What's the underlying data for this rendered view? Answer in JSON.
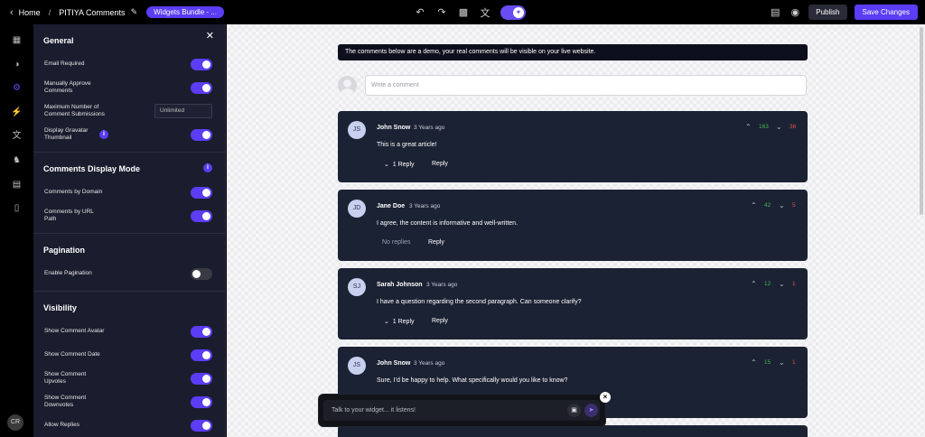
{
  "topbar": {
    "back_label": "Home",
    "separator": "/",
    "widget_name": "PITIYA Comments",
    "bundle_label": "Widgets Bundle - ...",
    "publish_label": "Publish",
    "save_label": "Save Changes",
    "icons": [
      "undo-icon",
      "redo-icon",
      "paint-icon",
      "translate-icon",
      "ai-assistant-icon",
      "database-icon",
      "eye-icon"
    ]
  },
  "rail": {
    "items": [
      "dashboard-icon",
      "palette-icon",
      "gear-icon",
      "plug-icon",
      "translate-icon",
      "bell-icon",
      "layout-icon",
      "analytics-icon"
    ],
    "active": "gear-icon",
    "avatar_initials": "CR"
  },
  "panel": {
    "general": {
      "title": "General",
      "email_required": "Email Required",
      "manually_approve": "Manually Approve Comments",
      "max_submissions": "Maximum Number of Comment Submissions",
      "max_submissions_value": "Unlimited",
      "display_gravatar": "Display Gravatar Thumbnail"
    },
    "display_mode": {
      "title": "Comments Display Mode",
      "by_domain": "Comments by Domain",
      "by_url": "Comments by URL Path"
    },
    "pagination": {
      "title": "Pagination",
      "enable": "Enable Pagination"
    },
    "visibility": {
      "title": "Visibility",
      "avatar": "Show Comment Avatar",
      "date": "Show Comment Date",
      "upvotes": "Show Comment Upvotes",
      "downvotes": "Show Comment Downvotes",
      "replies": "Allow Replies"
    },
    "toggles": {
      "email_required": true,
      "manually_approve": true,
      "display_gravatar": true,
      "by_domain": true,
      "by_url": true,
      "pagination": false,
      "avatar": true,
      "date": true,
      "upvotes": true,
      "downvotes": true,
      "replies": true
    }
  },
  "preview": {
    "banner": "The comments below are a demo, your real comments will be visible on your live website.",
    "input_placeholder": "Write a comment",
    "reply_label": "Reply",
    "comments": [
      {
        "initials": "JS",
        "author": "John Snow",
        "time": "3 Years ago",
        "text": "This is a great article!",
        "replies": "1 Reply",
        "up": "163",
        "down": "36"
      },
      {
        "initials": "JD",
        "author": "Jane Doe",
        "time": "3 Years ago",
        "text": "I agree, the content is informative and well-written.",
        "replies": "No replies",
        "up": "42",
        "down": "5"
      },
      {
        "initials": "SJ",
        "author": "Sarah Johnson",
        "time": "3 Years ago",
        "text": "I have a question regarding the second paragraph. Can someone clarify?",
        "replies": "1 Reply",
        "up": "12",
        "down": "1"
      },
      {
        "initials": "JS",
        "author": "John Snow",
        "time": "3 Years ago",
        "text": "Sure, I'd be happy to help. What specifically would you like to know?",
        "replies": "",
        "up": "15",
        "down": "1"
      }
    ]
  },
  "chat": {
    "placeholder": "Talk to your widget... it listens!"
  },
  "colors": {
    "accent": "#5b3df5",
    "panel_bg": "#1a1d2e",
    "card_bg": "#1b2233",
    "upvote": "#3fb950",
    "downvote": "#e05252"
  }
}
